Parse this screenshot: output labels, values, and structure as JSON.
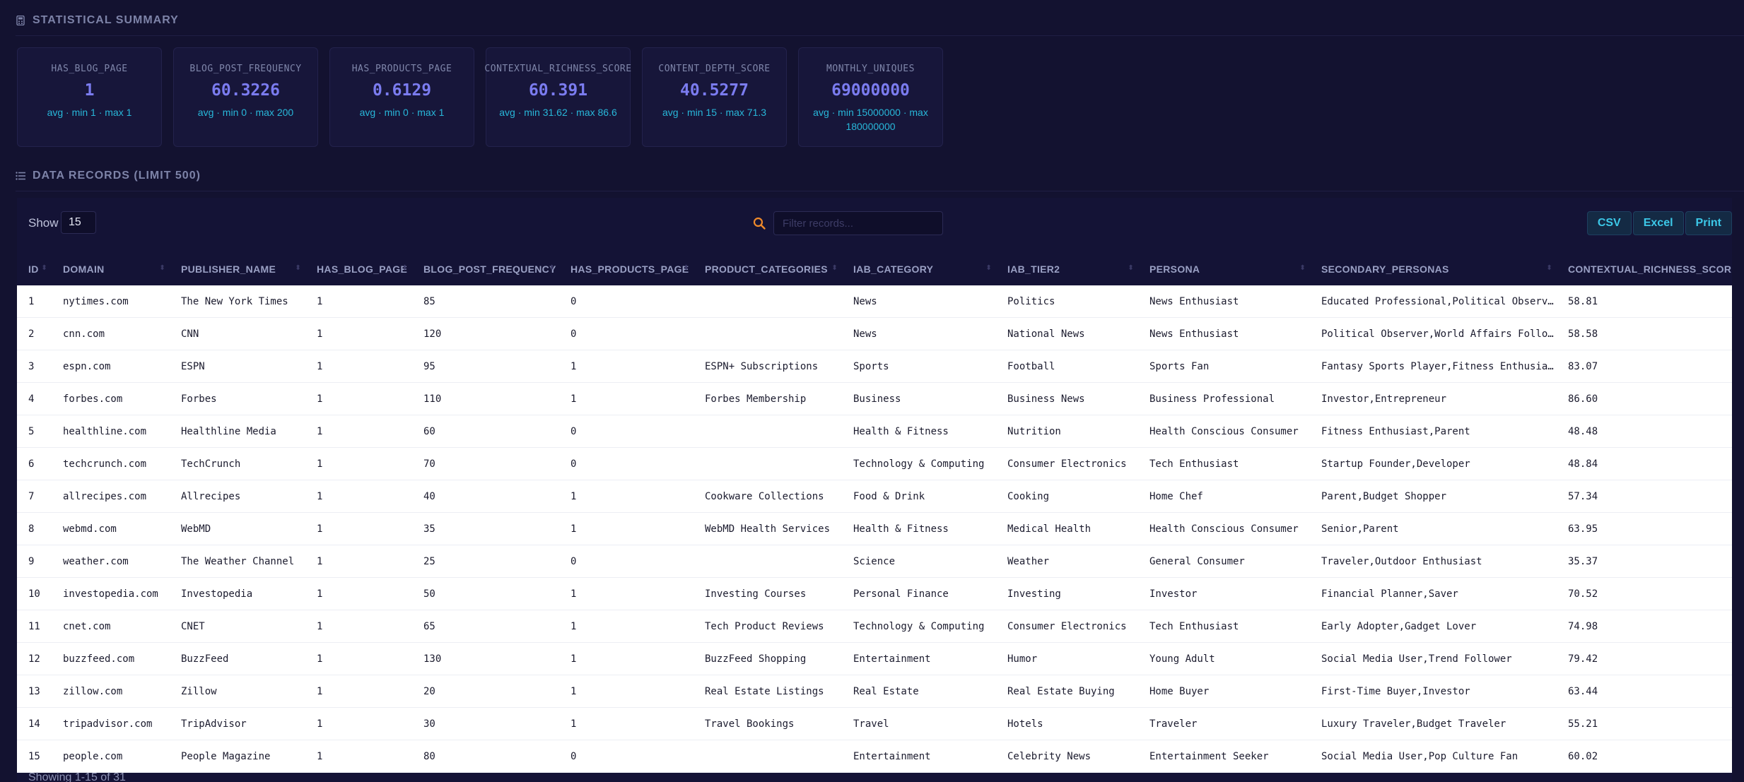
{
  "summary": {
    "title": "STATISTICAL SUMMARY",
    "cards": [
      {
        "label": "HAS_BLOG_PAGE",
        "value": "1",
        "sub": "avg · min 1 · max 1"
      },
      {
        "label": "BLOG_POST_FREQUENCY",
        "value": "60.3226",
        "sub": "avg · min 0 · max 200"
      },
      {
        "label": "HAS_PRODUCTS_PAGE",
        "value": "0.6129",
        "sub": "avg · min 0 · max 1"
      },
      {
        "label": "CONTEXTUAL_RICHNESS_SCORE",
        "value": "60.391",
        "sub": "avg · min 31.62 · max 86.6"
      },
      {
        "label": "CONTENT_DEPTH_SCORE",
        "value": "40.5277",
        "sub": "avg · min 15 · max 71.3"
      },
      {
        "label": "MONTHLY_UNIQUES",
        "value": "69000000",
        "sub": "avg · min 15000000 · max 180000000"
      }
    ]
  },
  "records": {
    "title": "DATA RECORDS (LIMIT 500)",
    "show_label": "Show",
    "show_value": "15",
    "search_placeholder": "Filter records...",
    "buttons": {
      "csv": "CSV",
      "excel": "Excel",
      "print": "Print"
    },
    "columns": [
      "ID",
      "DOMAIN",
      "PUBLISHER_NAME",
      "HAS_BLOG_PAGE",
      "BLOG_POST_FREQUENCY",
      "HAS_PRODUCTS_PAGE",
      "PRODUCT_CATEGORIES",
      "IAB_CATEGORY",
      "IAB_TIER2",
      "PERSONA",
      "SECONDARY_PERSONAS",
      "CONTEXTUAL_RICHNESS_SCORE"
    ],
    "rows": [
      [
        "1",
        "nytimes.com",
        "The New York Times",
        "1",
        "85",
        "0",
        "",
        "News",
        "Politics",
        "News Enthusiast",
        "Educated Professional,Political Observer",
        "58.81"
      ],
      [
        "2",
        "cnn.com",
        "CNN",
        "1",
        "120",
        "0",
        "",
        "News",
        "National News",
        "News Enthusiast",
        "Political Observer,World Affairs Follower",
        "58.58"
      ],
      [
        "3",
        "espn.com",
        "ESPN",
        "1",
        "95",
        "1",
        "ESPN+ Subscriptions",
        "Sports",
        "Football",
        "Sports Fan",
        "Fantasy Sports Player,Fitness Enthusiast",
        "83.07"
      ],
      [
        "4",
        "forbes.com",
        "Forbes",
        "1",
        "110",
        "1",
        "Forbes Membership",
        "Business",
        "Business News",
        "Business Professional",
        "Investor,Entrepreneur",
        "86.60"
      ],
      [
        "5",
        "healthline.com",
        "Healthline Media",
        "1",
        "60",
        "0",
        "",
        "Health & Fitness",
        "Nutrition",
        "Health Conscious Consumer",
        "Fitness Enthusiast,Parent",
        "48.48"
      ],
      [
        "6",
        "techcrunch.com",
        "TechCrunch",
        "1",
        "70",
        "0",
        "",
        "Technology & Computing",
        "Consumer Electronics",
        "Tech Enthusiast",
        "Startup Founder,Developer",
        "48.84"
      ],
      [
        "7",
        "allrecipes.com",
        "Allrecipes",
        "1",
        "40",
        "1",
        "Cookware Collections",
        "Food & Drink",
        "Cooking",
        "Home Chef",
        "Parent,Budget Shopper",
        "57.34"
      ],
      [
        "8",
        "webmd.com",
        "WebMD",
        "1",
        "35",
        "1",
        "WebMD Health Services",
        "Health & Fitness",
        "Medical Health",
        "Health Conscious Consumer",
        "Senior,Parent",
        "63.95"
      ],
      [
        "9",
        "weather.com",
        "The Weather Channel",
        "1",
        "25",
        "0",
        "",
        "Science",
        "Weather",
        "General Consumer",
        "Traveler,Outdoor Enthusiast",
        "35.37"
      ],
      [
        "10",
        "investopedia.com",
        "Investopedia",
        "1",
        "50",
        "1",
        "Investing Courses",
        "Personal Finance",
        "Investing",
        "Investor",
        "Financial Planner,Saver",
        "70.52"
      ],
      [
        "11",
        "cnet.com",
        "CNET",
        "1",
        "65",
        "1",
        "Tech Product Reviews",
        "Technology & Computing",
        "Consumer Electronics",
        "Tech Enthusiast",
        "Early Adopter,Gadget Lover",
        "74.98"
      ],
      [
        "12",
        "buzzfeed.com",
        "BuzzFeed",
        "1",
        "130",
        "1",
        "BuzzFeed Shopping",
        "Entertainment",
        "Humor",
        "Young Adult",
        "Social Media User,Trend Follower",
        "79.42"
      ],
      [
        "13",
        "zillow.com",
        "Zillow",
        "1",
        "20",
        "1",
        "Real Estate Listings",
        "Real Estate",
        "Real Estate Buying",
        "Home Buyer",
        "First-Time Buyer,Investor",
        "63.44"
      ],
      [
        "14",
        "tripadvisor.com",
        "TripAdvisor",
        "1",
        "30",
        "1",
        "Travel Bookings",
        "Travel",
        "Hotels",
        "Traveler",
        "Luxury Traveler,Budget Traveler",
        "55.21"
      ],
      [
        "15",
        "people.com",
        "People Magazine",
        "1",
        "80",
        "0",
        "",
        "Entertainment",
        "Celebrity News",
        "Entertainment Seeker",
        "Social Media User,Pop Culture Fan",
        "60.02"
      ]
    ],
    "footer": "Showing 1-15 of 31"
  },
  "colors": {
    "accent": "#7b7cf0",
    "sub": "#28b7d9",
    "search_icon": "#f08a2a",
    "background": "#131230"
  }
}
